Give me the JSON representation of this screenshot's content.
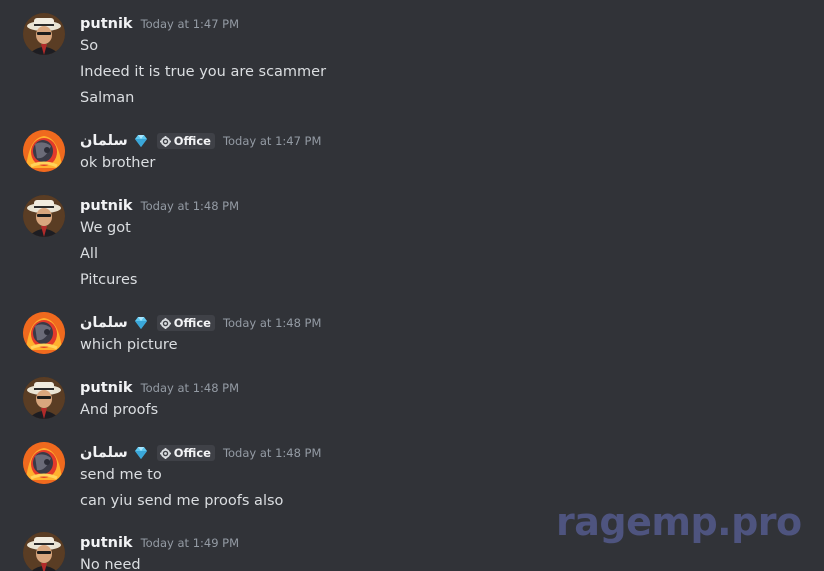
{
  "messages": [
    {
      "author": "putnik",
      "author_type": "putnik",
      "time": "Today at 1:47 PM",
      "lines": [
        "So",
        "Indeed it is true you are scammer",
        "Salman"
      ]
    },
    {
      "author": "سلمان",
      "author_type": "salman",
      "badge_icon": "diamond-gem-icon",
      "tag": "Office",
      "time": "Today at 1:47 PM",
      "lines": [
        "ok brother"
      ]
    },
    {
      "author": "putnik",
      "author_type": "putnik",
      "time": "Today at 1:48 PM",
      "lines": [
        "We got",
        "All",
        "Pitcures"
      ]
    },
    {
      "author": "سلمان",
      "author_type": "salman",
      "badge_icon": "diamond-gem-icon",
      "tag": "Office",
      "time": "Today at 1:48 PM",
      "lines": [
        "which picture"
      ]
    },
    {
      "author": "putnik",
      "author_type": "putnik",
      "time": "Today at 1:48 PM",
      "lines": [
        "And proofs"
      ]
    },
    {
      "author": "سلمان",
      "author_type": "salman",
      "badge_icon": "diamond-gem-icon",
      "tag": "Office",
      "time": "Today at 1:48 PM",
      "lines": [
        "send me to",
        "can yiu send me proofs also"
      ]
    },
    {
      "author": "putnik",
      "author_type": "putnik",
      "time": "Today at 1:49 PM",
      "lines": [
        "No need"
      ]
    }
  ],
  "watermark": "ragemp.pro",
  "colors": {
    "background": "#313338",
    "username": "#f2f3f5",
    "text": "#dbdee1",
    "timestamp": "#949ba4",
    "tag_bg": "#3f4147",
    "gem": "#5ec8f0",
    "watermark": "#545a8c"
  }
}
